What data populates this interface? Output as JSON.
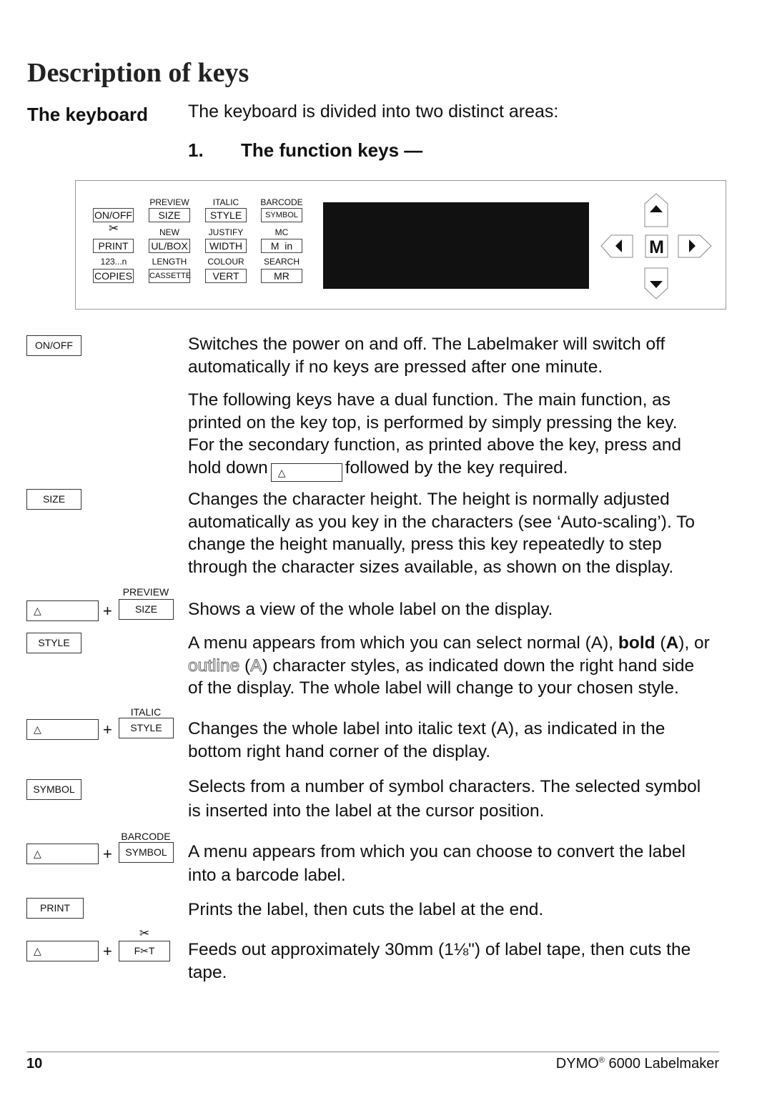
{
  "title": "Description of keys",
  "section": "The keyboard",
  "intro": "The keyboard is divided into two distinct areas:",
  "subheading": {
    "number": "1.",
    "text": "The function keys —"
  },
  "keyboard": {
    "keys": [
      {
        "top": "",
        "label": "ON/OFF"
      },
      {
        "top": "PREVIEW",
        "label": "SIZE"
      },
      {
        "top": "ITALIC",
        "label": "STYLE"
      },
      {
        "top": "BARCODE",
        "label": "SYMBOL"
      },
      {
        "top": "✂",
        "label": "PRINT"
      },
      {
        "top": "NEW",
        "label": "UL/BOX"
      },
      {
        "top": "JUSTIFY",
        "label": "WIDTH"
      },
      {
        "top": "MC",
        "label": "M  in"
      },
      {
        "top": "123...n",
        "label": "COPIES"
      },
      {
        "top": "LENGTH",
        "label": "CASSETTE"
      },
      {
        "top": "COLOUR",
        "label": "VERT"
      },
      {
        "top": "SEARCH",
        "label": "MR"
      }
    ],
    "m_key": "M"
  },
  "shift_symbol": "△",
  "plus": "+",
  "entries": {
    "onoff": {
      "key": "ON/OFF",
      "lines": [
        "Switches the power on and off.  The Labelmaker will switch off",
        "automatically if no keys are pressed after one minute."
      ]
    },
    "dual": {
      "lines": [
        "The following keys have a dual function. The main function, as",
        "printed on the key top, is performed by simply pressing the key.",
        "For the secondary function, as printed above the key, press and"
      ],
      "last_before": "hold down",
      "last_after": "followed by the key required."
    },
    "size": {
      "key": "SIZE",
      "lines": [
        "Changes the character height. The height is normally adjusted",
        "automatically as you key in the characters (see ‘Auto-scaling’). To",
        "change the height manually, press this key repeatedly to step",
        "through the character sizes available, as shown on the display."
      ]
    },
    "preview": {
      "label": "PREVIEW",
      "key": "SIZE",
      "lines": [
        "Shows a view of the whole label on the display."
      ]
    },
    "style": {
      "key": "STYLE",
      "l1a": "A menu appears from which you can select normal (A), ",
      "l1b": "bold",
      "l1c": " (",
      "l1d": "A",
      "l1e": "), or",
      "l2a": "outline",
      "l2b": " (",
      "l2c": "A",
      "l2d": ") character styles, as indicated down the right hand side",
      "l3": "of the display. The whole label will change to your chosen style."
    },
    "italic": {
      "label": "ITALIC",
      "key": "STYLE",
      "lines": [
        "Changes the whole label into italic text (A), as indicated in the",
        "bottom right hand corner of the display."
      ]
    },
    "symbol": {
      "key": "SYMBOL",
      "lines": [
        "Selects from a number of symbol characters. The selected symbol",
        "is inserted into the label at the cursor position."
      ]
    },
    "barcode": {
      "label": "BARCODE",
      "key": "SYMBOL",
      "lines": [
        "A menu appears from which you can choose to convert the label",
        "into a barcode label."
      ]
    },
    "print": {
      "key": "PRINT",
      "lines": [
        "Prints the label, then cuts the label at the end."
      ]
    },
    "feed": {
      "label": "✂",
      "key": "F✂T",
      "lines": [
        "Feeds out approximately 30mm (1⅛\") of label tape, then cuts the",
        "tape."
      ]
    }
  },
  "footer": {
    "page": "10",
    "brand": "DYMO",
    "reg": "®",
    "product": " 6000 Labelmaker"
  }
}
